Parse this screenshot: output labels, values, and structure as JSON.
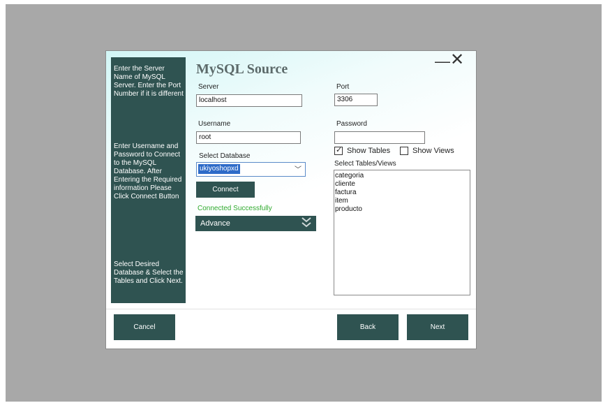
{
  "dialog": {
    "title": "MySQL Source",
    "minimize_glyph": "—",
    "close_glyph": "✕"
  },
  "sidebar": {
    "step1": "Enter the Server Name of MySQL Server. Enter the Port Number if it is different",
    "step2": "Enter Username and Password to Connect to the MySQL Database. After Entering the Required information Please Click Connect Button",
    "step3": "Select Desired Database & Select the Tables and Click Next."
  },
  "form": {
    "server_label": "Server",
    "server_value": "localhost",
    "port_label": "Port",
    "port_value": "3306",
    "username_label": "Username",
    "username_value": "root",
    "password_label": "Password",
    "password_value": "",
    "database_label": "Select Database",
    "database_value": "ukiyoshopxd",
    "connect_label": "Connect",
    "status_text": "Connected Successfully",
    "advance_label": "Advance",
    "show_tables_label": "Show Tables",
    "show_tables_checked": true,
    "show_views_label": "Show Views",
    "show_views_checked": false,
    "tables_label": "Select Tables/Views",
    "tables": [
      "categoria",
      "cliente",
      "factura",
      "item",
      "producto"
    ]
  },
  "footer": {
    "cancel_label": "Cancel",
    "back_label": "Back",
    "next_label": "Next"
  },
  "colors": {
    "sidebar_bg": "#2f5351",
    "backdrop": "#a8a8a8",
    "success": "#2eaa2e",
    "selection": "#2d6bc8"
  },
  "icons": {
    "dropdown": "chevron-down-icon",
    "advance": "double-chevron-down-icon",
    "checkbox": "checkmark-icon"
  }
}
